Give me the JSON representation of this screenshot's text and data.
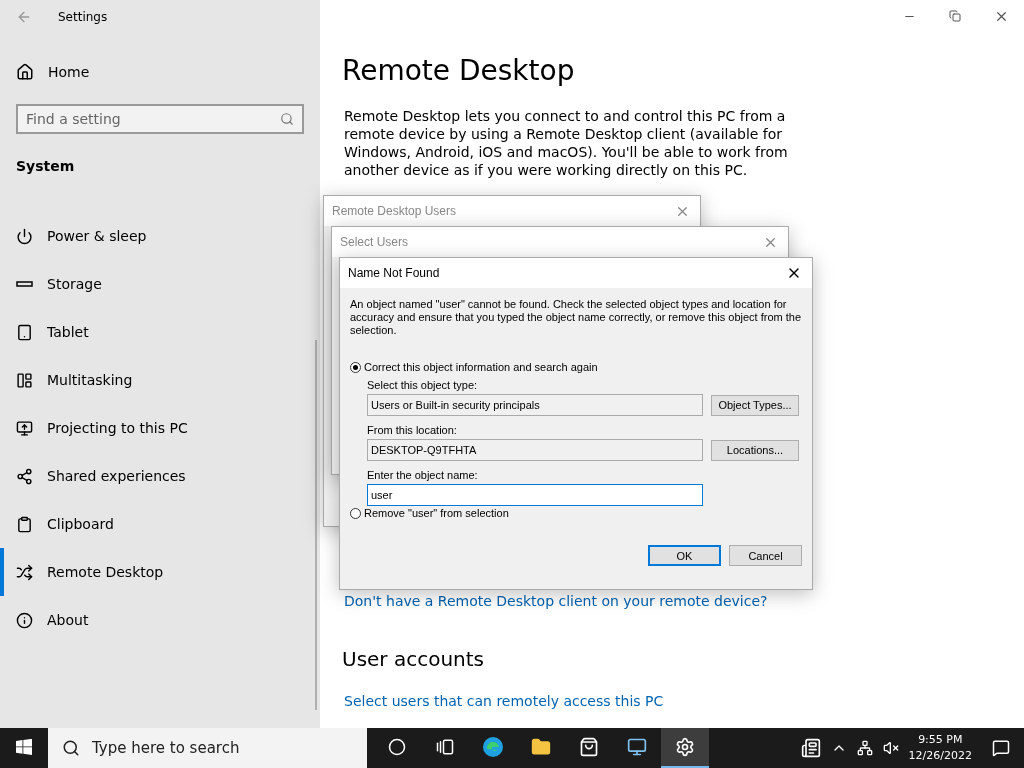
{
  "window": {
    "title": "Settings"
  },
  "sidebar": {
    "home": "Home",
    "search": {
      "placeholder": "Find a setting"
    },
    "section": "System",
    "items": [
      {
        "label": "Power & sleep",
        "kind": "power",
        "selected": false
      },
      {
        "label": "Storage",
        "kind": "storage",
        "selected": false
      },
      {
        "label": "Tablet",
        "kind": "tablet",
        "selected": false
      },
      {
        "label": "Multitasking",
        "kind": "multitasking",
        "selected": false
      },
      {
        "label": "Projecting to this PC",
        "kind": "projecting",
        "selected": false
      },
      {
        "label": "Shared experiences",
        "kind": "shared",
        "selected": false
      },
      {
        "label": "Clipboard",
        "kind": "clipboard",
        "selected": false
      },
      {
        "label": "Remote Desktop",
        "kind": "remote",
        "selected": true
      },
      {
        "label": "About",
        "kind": "about",
        "selected": false
      }
    ]
  },
  "main": {
    "title": "Remote Desktop",
    "description": "Remote Desktop lets you connect to and control this PC from a remote device by using a Remote Desktop client (available for Windows, Android, iOS and macOS). You'll be able to work from another device as if you were working directly on this PC.",
    "client_link": "Don't have a Remote Desktop client on your remote device?",
    "section": "User accounts",
    "users_link": "Select users that can remotely access this PC"
  },
  "background_dialogs": [
    {
      "title": "Remote Desktop Users"
    },
    {
      "title": "Select Users"
    }
  ],
  "name_not_found": {
    "title": "Name Not Found",
    "message": "An object named \"user\" cannot be found. Check the selected object types and location for accuracy and ensure that you typed the object name correctly, or remove this object from the selection.",
    "options": [
      {
        "label": "Correct this object information and search again",
        "selected": true
      },
      {
        "label": "Remove \"user\" from selection",
        "selected": false
      }
    ],
    "object_type": {
      "label": "Select this object type:",
      "value": "Users or Built-in security principals",
      "button": "Object Types..."
    },
    "location": {
      "label": "From this location:",
      "value": "DESKTOP-Q9TFHTA",
      "button": "Locations..."
    },
    "object_name": {
      "label": "Enter the object name:",
      "value": "user"
    },
    "buttons": [
      "OK",
      "Cancel"
    ]
  },
  "taskbar": {
    "search": {
      "placeholder": "Type here to search"
    },
    "apps": [
      {
        "kind": "cortana",
        "selected": false
      },
      {
        "kind": "taskview",
        "selected": false
      },
      {
        "kind": "edge",
        "selected": false
      },
      {
        "kind": "explorer",
        "selected": false
      },
      {
        "kind": "store",
        "selected": false
      },
      {
        "kind": "remote",
        "selected": false
      },
      {
        "kind": "settings",
        "selected": true
      }
    ],
    "time": "9:55 PM",
    "date": "12/26/2022"
  }
}
